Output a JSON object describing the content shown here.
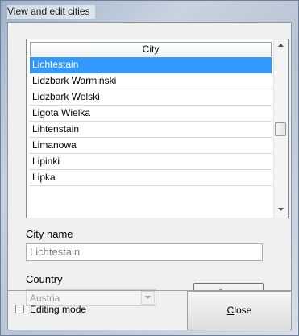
{
  "window": {
    "title": "View and edit cities"
  },
  "list": {
    "header": "City",
    "items": [
      "Lichtestain",
      "Lidzbark Warmiński",
      "Lidzbark Welski",
      "Ligota Wielka",
      "Lihtenstain",
      "Limanowa",
      "Lipinki",
      "Lipka"
    ],
    "selected_index": 0
  },
  "city_name": {
    "label": "City name",
    "value": "Lichtestain"
  },
  "country": {
    "label": "Country",
    "value": "Austria"
  },
  "buttons": {
    "save_mnemonic": "S",
    "save_rest": "ave",
    "close_mnemonic": "C",
    "close_rest": "lose"
  },
  "editing_mode": {
    "label": "Editing mode",
    "checked": false
  },
  "icons": {
    "scroll_up": "scroll-up-arrow-icon",
    "scroll_down": "scroll-down-arrow-icon",
    "dropdown": "chevron-down-icon"
  },
  "colors": {
    "selection": "#3399ff"
  }
}
